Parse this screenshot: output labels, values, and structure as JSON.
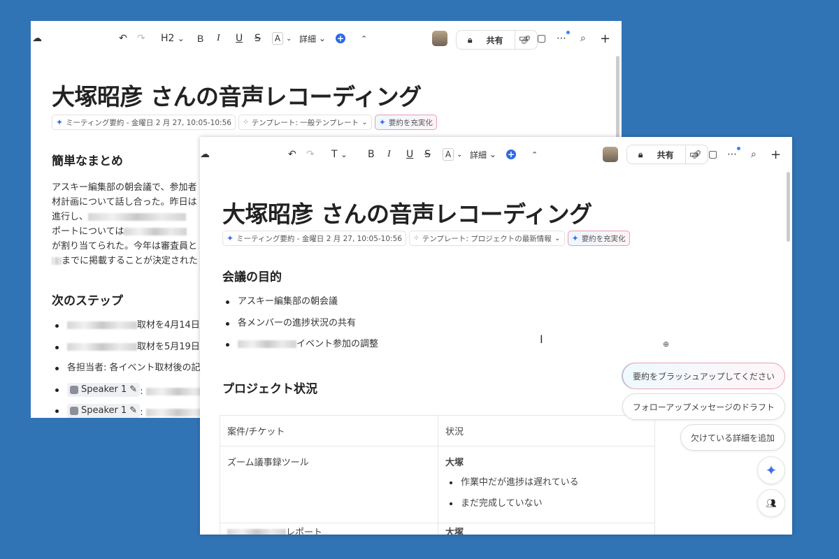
{
  "back": {
    "toolbar": {
      "heading": "H2",
      "bold": "B",
      "italic": "I",
      "underline": "U",
      "strike": "S",
      "color": "A",
      "more": "詳細",
      "share": "共有"
    },
    "title": "大塚昭彦 さんの音声レコーディング",
    "chips": {
      "meeting": "ミーティング要約 - 金曜日 2 月 27, 10:05-10:56",
      "template": "テンプレート: 一般テンプレート",
      "enhance": "要約を充実化"
    },
    "summary_heading": "簡単なまとめ",
    "summary_lines": [
      "アスキー編集部の朝会議で、参加者",
      "材計画について話し合った。昨日は",
      "進行し、",
      "ポートについては",
      "が割り当てられた。今年は審査員と",
      "までに掲載することが決定された"
    ],
    "next_heading": "次のステップ",
    "next_items": [
      "取材を4月14日",
      "取材を5月19日",
      "各担当者: 各イベント取材後の記"
    ],
    "speaker": "Speaker 1"
  },
  "front": {
    "toolbar": {
      "heading": "T",
      "bold": "B",
      "italic": "I",
      "underline": "U",
      "strike": "S",
      "color": "A",
      "more": "詳細",
      "share": "共有"
    },
    "title": "大塚昭彦 さんの音声レコーディング",
    "chips": {
      "meeting": "ミーティング要約 - 金曜日 2 月 27, 10:05-10:56",
      "template": "テンプレート: プロジェクトの最新情報",
      "enhance": "要約を充実化"
    },
    "purpose_heading": "会議の目的",
    "purpose_items": [
      "アスキー編集部の朝会議",
      "各メンバーの進捗状況の共有",
      "イベント参加の調整"
    ],
    "status_heading": "プロジェクト状況",
    "table": {
      "headers": [
        "案件/チケット",
        "状況"
      ],
      "rows": [
        {
          "item": "ズーム議事録ツール",
          "owner": "大塚",
          "notes": [
            "作業中だが進捗は遅れている",
            "まだ完成していない"
          ]
        },
        {
          "item": "レポート",
          "owner": "大塚"
        }
      ]
    },
    "suggestions": [
      "要約をブラッシュアップしてください",
      "フォローアップメッセージのドラフト",
      "欠けている詳細を追加"
    ]
  }
}
